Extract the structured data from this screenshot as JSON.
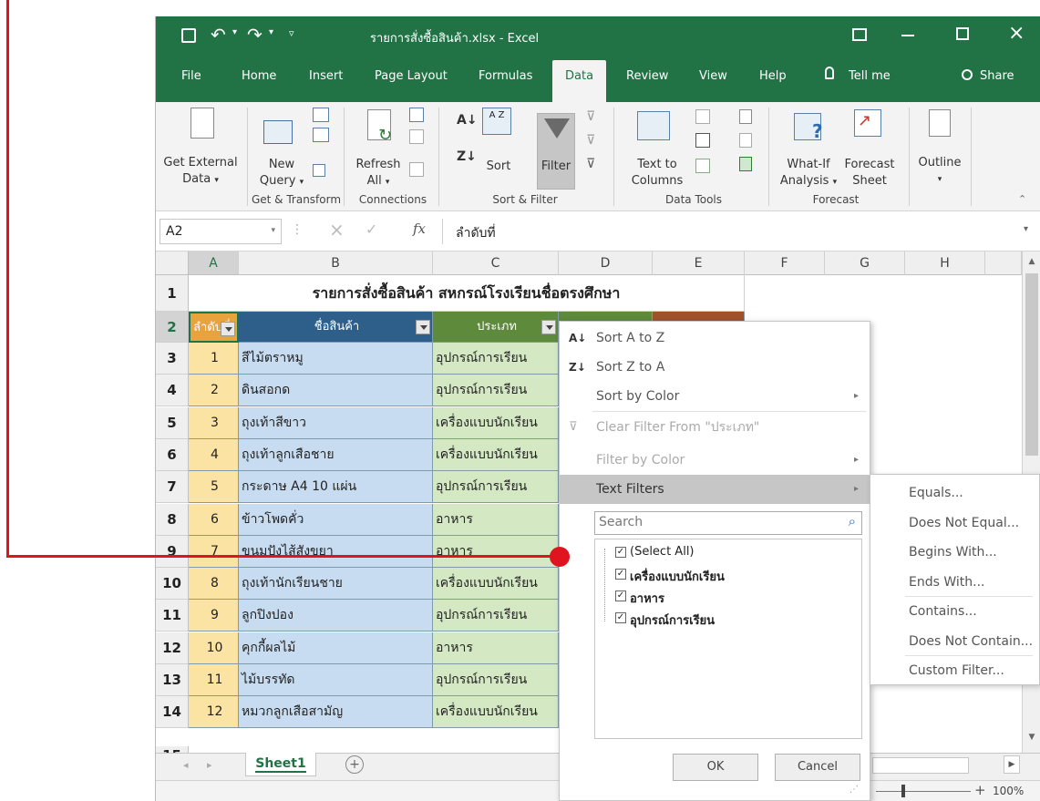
{
  "title_bar": {
    "filename": "รายการสั่งซื้อสินค้า.xlsx",
    "separator": "-",
    "app": "Excel"
  },
  "tabs": [
    "File",
    "Home",
    "Insert",
    "Page Layout",
    "Formulas",
    "Data",
    "Review",
    "View",
    "Help",
    "Tell me",
    "Share"
  ],
  "ribbon": {
    "get_external": "Get External",
    "get_external_2": "Data",
    "new_query": "New",
    "new_query_2": "Query",
    "refresh": "Refresh",
    "refresh_2": "All",
    "sort_az": "A Z",
    "sort": "Sort",
    "filter": "Filter",
    "text_to": "Text to",
    "columns": "Columns",
    "whatif": "What-If",
    "analysis": "Analysis",
    "forecast": "Forecast",
    "sheet": "Sheet",
    "outline": "Outline",
    "groups": [
      "Get & Transform",
      "Connections",
      "Sort & Filter",
      "Data Tools",
      "Forecast"
    ]
  },
  "formula_bar": {
    "name_box": "A2",
    "fx": "fx",
    "content": "ลำดับที่"
  },
  "columns": [
    "A",
    "B",
    "C",
    "D",
    "E",
    "F",
    "G",
    "H"
  ],
  "sheet_title": "รายการสั่งซื้อสินค้า สหกรณ์โรงเรียนชื่อตรงศึกษา",
  "headers": {
    "a": "ลำดับที่",
    "b": "ชื่อสินค้า",
    "c": "ประเภท"
  },
  "rows": [
    {
      "n": "3",
      "a": "1",
      "b": "สีไม้ตราหมู",
      "c": "อุปกรณ์การเรียน"
    },
    {
      "n": "4",
      "a": "2",
      "b": "ดินสอกด",
      "c": "อุปกรณ์การเรียน"
    },
    {
      "n": "5",
      "a": "3",
      "b": "ถุงเท้าสีขาว",
      "c": "เครื่องแบบนักเรียน"
    },
    {
      "n": "6",
      "a": "4",
      "b": "ถุงเท้าลูกเสือชาย",
      "c": "เครื่องแบบนักเรียน"
    },
    {
      "n": "7",
      "a": "5",
      "b": "กระดาษ A4 10 แผ่น",
      "c": "อุปกรณ์การเรียน"
    },
    {
      "n": "8",
      "a": "6",
      "b": "ข้าวโพดคั่ว",
      "c": "อาหาร"
    },
    {
      "n": "9",
      "a": "7",
      "b": "ขนมปังไส้สังขยา",
      "c": "อาหาร"
    },
    {
      "n": "10",
      "a": "8",
      "b": "ถุงเท้านักเรียนชาย",
      "c": "เครื่องแบบนักเรียน"
    },
    {
      "n": "11",
      "a": "9",
      "b": "ลูกปิงปอง",
      "c": "อุปกรณ์การเรียน"
    },
    {
      "n": "12",
      "a": "10",
      "b": "คุกกี้ผลไม้",
      "c": "อาหาร"
    },
    {
      "n": "13",
      "a": "11",
      "b": "ไม้บรรทัด",
      "c": "อุปกรณ์การเรียน"
    },
    {
      "n": "14",
      "a": "12",
      "b": "หมวกลูกเสือสามัญ",
      "c": "เครื่องแบบนักเรียน"
    }
  ],
  "row_labels": {
    "r1": "1",
    "r2": "2",
    "r15": "15"
  },
  "sheet_tab": "Sheet1",
  "zoom": "100%",
  "menu": {
    "sort_az": "Sort A to Z",
    "sort_za": "Sort Z to A",
    "sort_color": "Sort by Color",
    "clear_filter": "Clear Filter From \"ประเภท\"",
    "filter_color": "Filter by Color",
    "text_filters": "Text Filters",
    "search_placeholder": "Search",
    "items": [
      "(Select All)",
      "เครื่องแบบนักเรียน",
      "อาหาร",
      "อุปกรณ์การเรียน"
    ],
    "ok": "OK",
    "cancel": "Cancel"
  },
  "submenu": [
    "Equals...",
    "Does Not Equal...",
    "Begins With...",
    "Ends With...",
    "Contains...",
    "Does Not Contain...",
    "Custom Filter..."
  ],
  "colors": {
    "excel_green": "#217346",
    "header_orange": "#e8a33d",
    "header_blue": "#2e5f8a",
    "header_green": "#5e8a3c",
    "col_a": "#fbe3a4",
    "col_b": "#c7dcf0",
    "col_c": "#d4e8c4",
    "annotation_red": "#e0141e"
  }
}
